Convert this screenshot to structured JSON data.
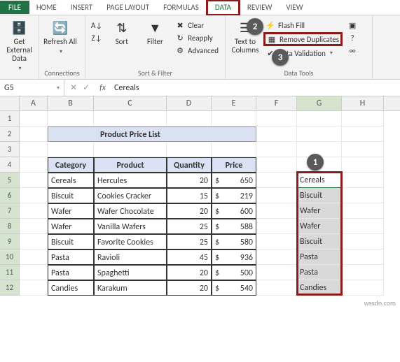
{
  "tabs": {
    "file": "FILE",
    "home": "HOME",
    "insert": "INSERT",
    "page_layout": "PAGE LAYOUT",
    "formulas": "FORMULAS",
    "data": "DATA",
    "review": "REVIEW",
    "view": "VIEW"
  },
  "ribbon": {
    "get_external": "Get External Data",
    "refresh": "Refresh All",
    "connections_grp": "Connections",
    "sort_az": "A→Z",
    "sort_za": "Z→A",
    "sort": "Sort",
    "filter": "Filter",
    "clear": "Clear",
    "reapply": "Reapply",
    "advanced": "Advanced",
    "sortfilter_grp": "Sort & Filter",
    "text_cols": "Text to Columns",
    "flash_fill": "Flash Fill",
    "remove_dup": "Remove Duplicates",
    "data_val": "Data Validation",
    "datatools_grp": "Data Tools"
  },
  "formula_bar": {
    "name_box": "G5",
    "fx": "fx",
    "value": "Cereals"
  },
  "columns": [
    "A",
    "B",
    "C",
    "D",
    "E",
    "F",
    "G",
    "H"
  ],
  "row_numbers": [
    "1",
    "2",
    "3",
    "4",
    "5",
    "6",
    "7",
    "8",
    "9",
    "10",
    "11",
    "12"
  ],
  "title": "Product Price List",
  "headers": {
    "cat": "Category",
    "prod": "Product",
    "qty": "Quantity",
    "price": "Price"
  },
  "table": [
    {
      "cat": "Cereals",
      "prod": "Hercules",
      "qty": "20",
      "cur": "$",
      "price": "650"
    },
    {
      "cat": "Biscuit",
      "prod": "Cookies Cracker",
      "qty": "15",
      "cur": "$",
      "price": "219"
    },
    {
      "cat": "Wafer",
      "prod": "Wafer Chocolate",
      "qty": "20",
      "cur": "$",
      "price": "600"
    },
    {
      "cat": "Wafer",
      "prod": "Vanilla Wafers",
      "qty": "25",
      "cur": "$",
      "price": "588"
    },
    {
      "cat": "Biscuit",
      "prod": "Favorite Cookies",
      "qty": "25",
      "cur": "$",
      "price": "580"
    },
    {
      "cat": "Pasta",
      "prod": "Ravioli",
      "qty": "45",
      "cur": "$",
      "price": "936"
    },
    {
      "cat": "Pasta",
      "prod": "Spaghetti",
      "qty": "20",
      "cur": "$",
      "price": "500"
    },
    {
      "cat": "Candies",
      "prod": "Karakum",
      "qty": "20",
      "cur": "$",
      "price": "540"
    }
  ],
  "colG": [
    "Cereals",
    "Biscuit",
    "Wafer",
    "Wafer",
    "Biscuit",
    "Pasta",
    "Pasta",
    "Candies"
  ],
  "callouts": {
    "c1": "1",
    "c2": "2",
    "c3": "3"
  },
  "footer": "wsxdn.com"
}
